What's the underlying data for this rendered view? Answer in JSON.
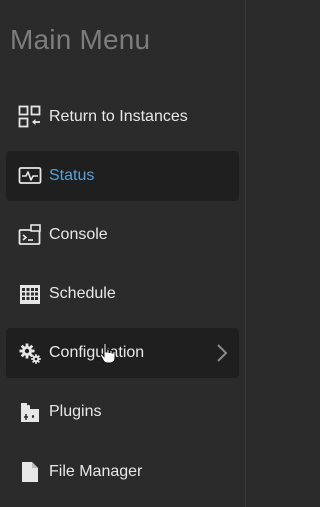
{
  "menu": {
    "title": "Main Menu",
    "items": [
      {
        "label": "Return to Instances",
        "icon": "grid-return-icon",
        "state": "normal"
      },
      {
        "label": "Status",
        "icon": "status-icon",
        "state": "active"
      },
      {
        "label": "Console",
        "icon": "console-icon",
        "state": "normal"
      },
      {
        "label": "Schedule",
        "icon": "schedule-icon",
        "state": "normal"
      },
      {
        "label": "Configuration",
        "icon": "gears-icon",
        "state": "hover",
        "has_submenu": true
      },
      {
        "label": "Plugins",
        "icon": "plugin-icon",
        "state": "normal"
      },
      {
        "label": "File Manager",
        "icon": "file-icon",
        "state": "normal"
      }
    ]
  },
  "colors": {
    "background": "#2b2b2b",
    "item_active_bg": "#1f1f1f",
    "active_text": "#5aa0d6",
    "title_text": "#7d7d7d",
    "item_text": "#e8e8e8"
  }
}
